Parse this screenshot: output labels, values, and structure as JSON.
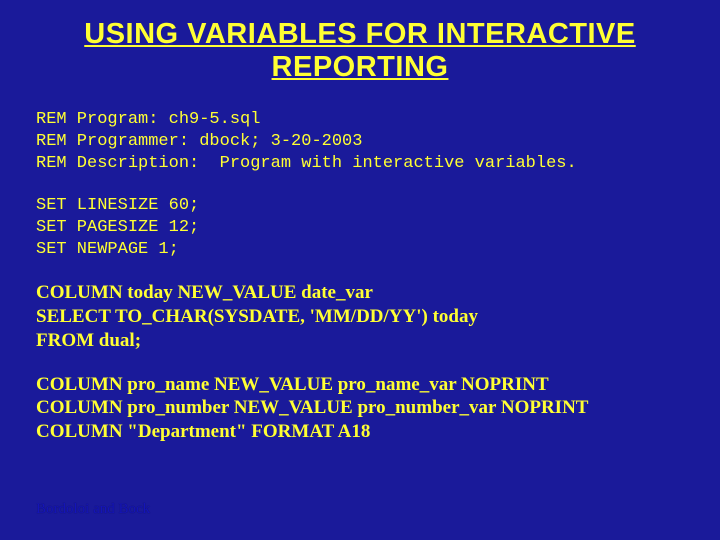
{
  "title": "USING VARIABLES FOR INTERACTIVE REPORTING",
  "code": {
    "block1": "REM Program: ch9-5.sql\nREM Programmer: dbock; 3-20-2003\nREM Description:  Program with interactive variables.",
    "block2": "SET LINESIZE 60;\nSET PAGESIZE 12;\nSET NEWPAGE 1;",
    "block3": "COLUMN today NEW_VALUE date_var\nSELECT TO_CHAR(SYSDATE, 'MM/DD/YY') today\nFROM dual;",
    "block4": "COLUMN pro_name NEW_VALUE pro_name_var NOPRINT\nCOLUMN pro_number NEW_VALUE pro_number_var NOPRINT\nCOLUMN \"Department\" FORMAT A18"
  },
  "footer": "Bordoloi and Bock"
}
